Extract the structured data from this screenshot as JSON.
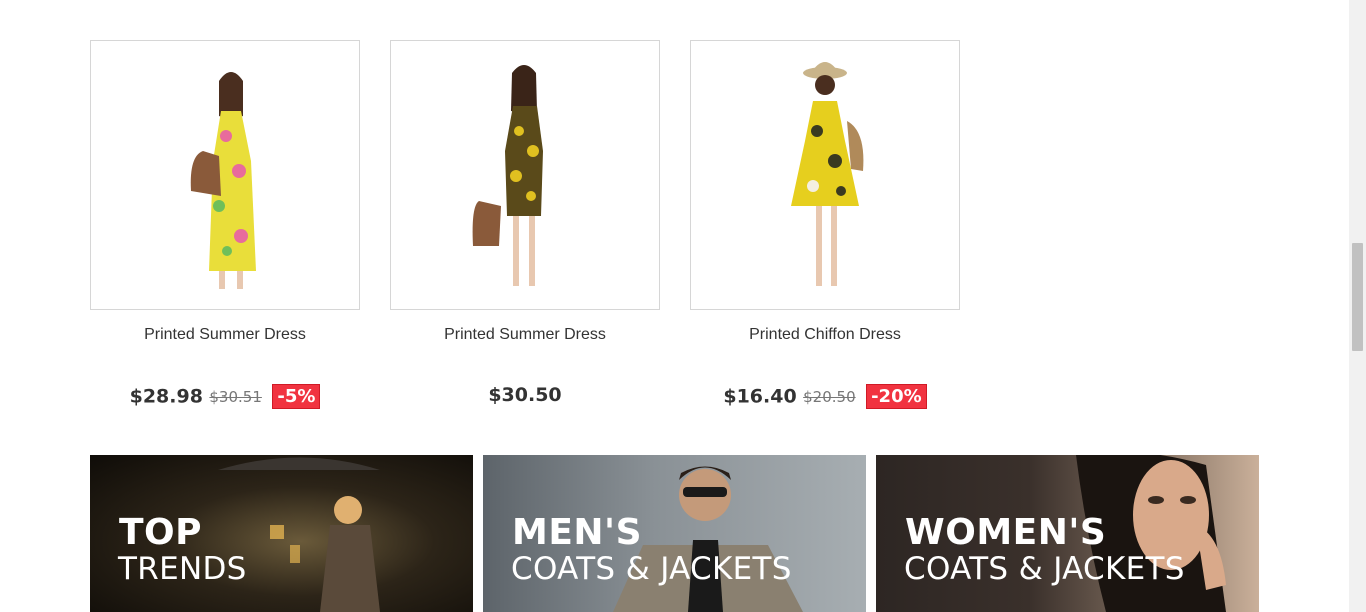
{
  "products": [
    {
      "name": "Printed Summer Dress",
      "price": "$28.98",
      "old_price": "$30.51",
      "discount": "-5%"
    },
    {
      "name": "Printed Summer Dress",
      "price": "$30.50",
      "old_price": "",
      "discount": ""
    },
    {
      "name": "Printed Chiffon Dress",
      "price": "$16.40",
      "old_price": "$20.50",
      "discount": "-20%"
    }
  ],
  "banners": [
    {
      "title": "TOP",
      "subtitle": "TRENDS"
    },
    {
      "title": "MEN'S",
      "subtitle": "COATS & JACKETS"
    },
    {
      "title": "WOMEN'S",
      "subtitle": "COATS & JACKETS"
    }
  ],
  "colors": {
    "discount_bg": "#f13340",
    "text": "#333333",
    "old_price": "#777777"
  }
}
